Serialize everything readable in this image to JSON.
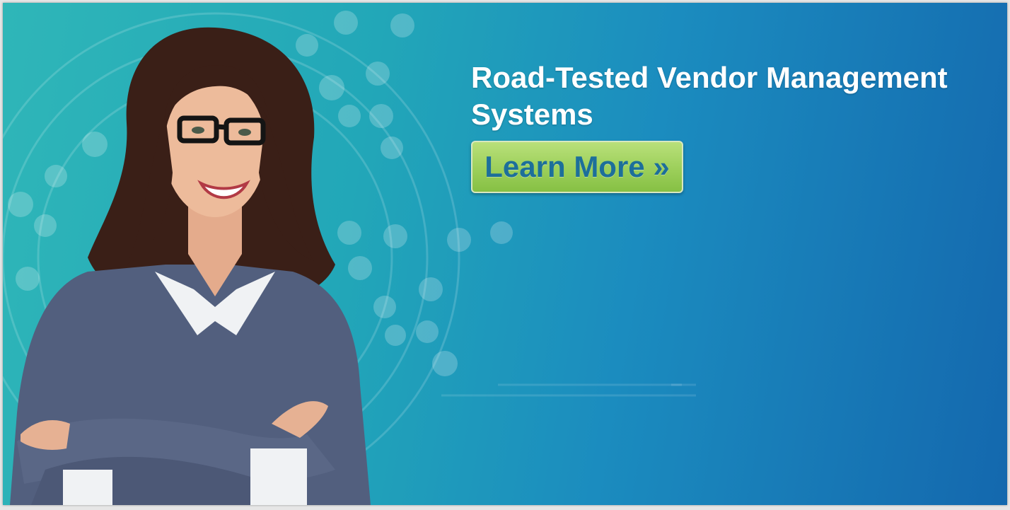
{
  "banner": {
    "headline": "Road-Tested Vendor Management Systems",
    "cta_label": "Learn More »",
    "colors": {
      "background_left": "#2fb6b8",
      "background_right": "#1468ae",
      "cta_green": "#9ccf5a",
      "cta_text": "#1d6f9a",
      "headline_text": "#ffffff"
    }
  }
}
